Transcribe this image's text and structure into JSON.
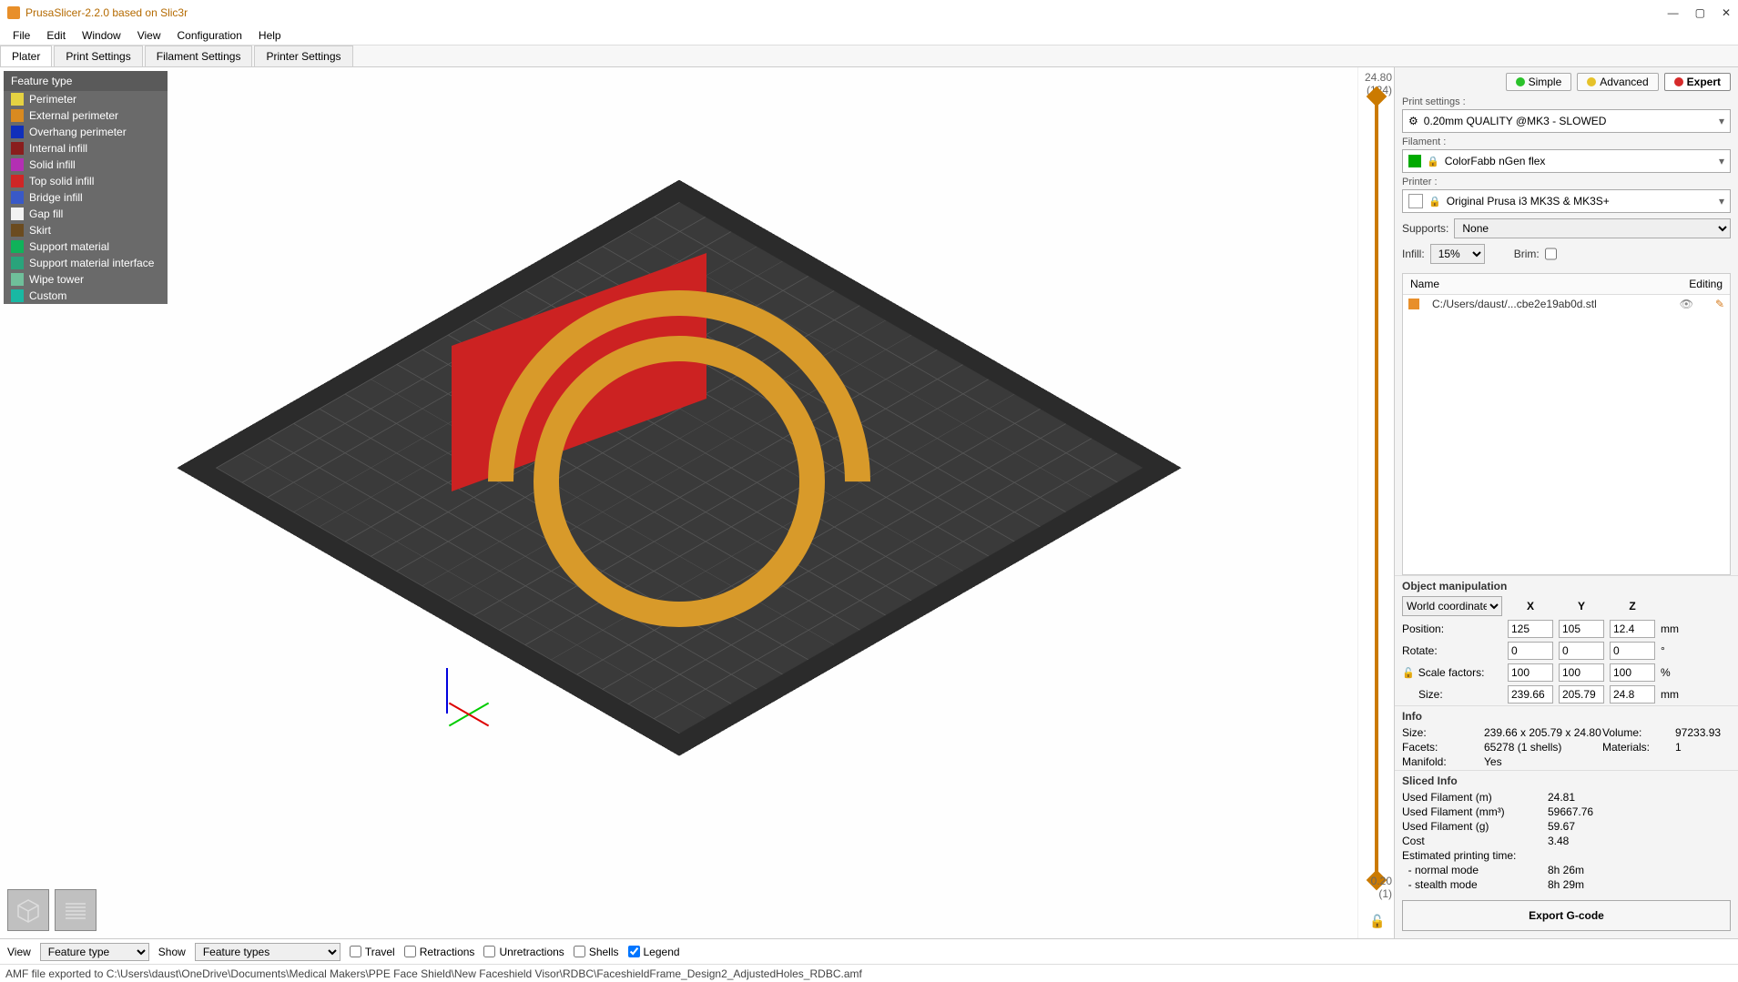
{
  "titlebar": {
    "title": "PrusaSlicer-2.2.0 based on Slic3r"
  },
  "menu": {
    "file": "File",
    "edit": "Edit",
    "window": "Window",
    "view": "View",
    "configuration": "Configuration",
    "help": "Help"
  },
  "tabs": {
    "plater": "Plater",
    "print": "Print Settings",
    "filament": "Filament Settings",
    "printer": "Printer Settings"
  },
  "legend": {
    "header": "Feature type",
    "items": [
      {
        "label": "Perimeter",
        "color": "#e5d242"
      },
      {
        "label": "External perimeter",
        "color": "#d98a20"
      },
      {
        "label": "Overhang perimeter",
        "color": "#102fbb"
      },
      {
        "label": "Internal infill",
        "color": "#8a1d1d"
      },
      {
        "label": "Solid infill",
        "color": "#b32fb3"
      },
      {
        "label": "Top solid infill",
        "color": "#cf2626"
      },
      {
        "label": "Bridge infill",
        "color": "#3959c7"
      },
      {
        "label": "Gap fill",
        "color": "#f2f2f2"
      },
      {
        "label": "Skirt",
        "color": "#6b4b1f"
      },
      {
        "label": "Support material",
        "color": "#10b25a"
      },
      {
        "label": "Support material interface",
        "color": "#2aa37b"
      },
      {
        "label": "Wipe tower",
        "color": "#6fbf9a"
      },
      {
        "label": "Custom",
        "color": "#19b8a3"
      }
    ]
  },
  "slider": {
    "top_val": "24.80",
    "top_idx": "(124)",
    "bot_val": "0.20",
    "bot_idx": "(1)"
  },
  "modes": {
    "simple": "Simple",
    "advanced": "Advanced",
    "expert": "Expert"
  },
  "settings": {
    "print_label": "Print settings :",
    "print_value": "0.20mm QUALITY @MK3 - SLOWED",
    "filament_label": "Filament :",
    "filament_value": "ColorFabb nGen flex",
    "printer_label": "Printer :",
    "printer_value": "Original Prusa i3 MK3S & MK3S+",
    "supports_label": "Supports:",
    "supports_value": "None",
    "infill_label": "Infill:",
    "infill_value": "15%",
    "brim_label": "Brim:"
  },
  "objlist": {
    "col_name": "Name",
    "col_edit": "Editing",
    "file": "C:/Users/daust/...cbe2e19ab0d.stl"
  },
  "manip": {
    "header": "Object manipulation",
    "coord": "World coordinates",
    "axes": {
      "x": "X",
      "y": "Y",
      "z": "Z"
    },
    "rows": {
      "position": {
        "label": "Position:",
        "x": "125",
        "y": "105",
        "z": "12.4",
        "unit": "mm"
      },
      "rotate": {
        "label": "Rotate:",
        "x": "0",
        "y": "0",
        "z": "0",
        "unit": "°"
      },
      "scale": {
        "label": "Scale factors:",
        "x": "100",
        "y": "100",
        "z": "100",
        "unit": "%"
      },
      "size": {
        "label": "Size:",
        "x": "239.66",
        "y": "205.79",
        "z": "24.8",
        "unit": "mm"
      }
    }
  },
  "info": {
    "header": "Info",
    "size_l": "Size:",
    "size_v": "239.66 x 205.79 x 24.80",
    "vol_l": "Volume:",
    "vol_v": "97233.93",
    "facets_l": "Facets:",
    "facets_v": "65278 (1 shells)",
    "mat_l": "Materials:",
    "mat_v": "1",
    "manifold_l": "Manifold:",
    "manifold_v": "Yes"
  },
  "sliced": {
    "header": "Sliced Info",
    "fil_m_l": "Used Filament (m)",
    "fil_m_v": "24.81",
    "fil_mm3_l": "Used Filament (mm³)",
    "fil_mm3_v": "59667.76",
    "fil_g_l": "Used Filament (g)",
    "fil_g_v": "59.67",
    "cost_l": "Cost",
    "cost_v": "3.48",
    "time_l": "Estimated printing time:",
    "normal_l": "  - normal mode",
    "normal_v": "8h 26m",
    "stealth_l": "  - stealth mode",
    "stealth_v": "8h 29m"
  },
  "export": "Export G-code",
  "bottom": {
    "view_l": "View",
    "view_v": "Feature type",
    "show_l": "Show",
    "show_v": "Feature types",
    "travel": "Travel",
    "retr": "Retractions",
    "unretr": "Unretractions",
    "shells": "Shells",
    "legend": "Legend"
  },
  "status": "AMF file exported to C:\\Users\\daust\\OneDrive\\Documents\\Medical Makers\\PPE Face Shield\\New Faceshield Visor\\RDBC\\FaceshieldFrame_Design2_AdjustedHoles_RDBC.amf"
}
